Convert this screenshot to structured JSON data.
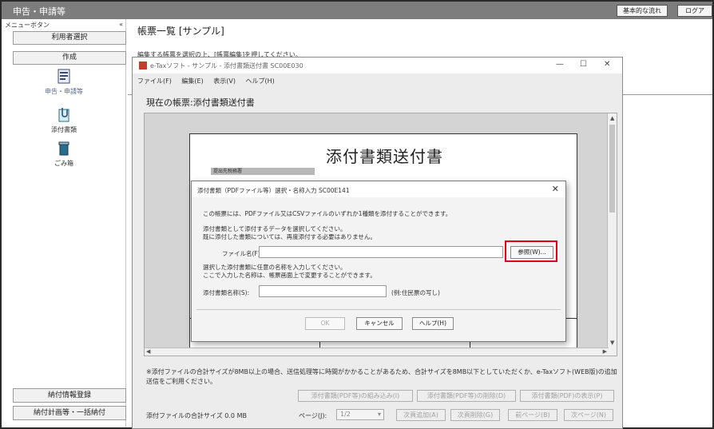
{
  "app": {
    "title": "申告・申請等",
    "top_buttons": [
      "基本的な流れ",
      "ログア"
    ]
  },
  "left_menu": {
    "header_label": "メニューボタン",
    "header_close": "«",
    "buttons": [
      "利用者選択",
      "作成"
    ],
    "icons": [
      {
        "label": "申告・申請等",
        "icon": "document-form-icon"
      },
      {
        "label": "添付書類",
        "icon": "clip-document-icon"
      },
      {
        "label": "ごみ箱",
        "icon": "trash-icon"
      }
    ],
    "bottom_buttons": [
      "納付情報登録",
      "納付計画等・一括納付"
    ]
  },
  "main": {
    "title": "帳票一覧 [サンプル]",
    "subtitle": "編集する帳票を選択の上、[帳票編集]を押してください。"
  },
  "etax_window": {
    "title": "e-Taxソフト - サンプル - 添付書類送付書 SC00E030",
    "controls": [
      "—",
      "☐",
      "✕"
    ],
    "menu": [
      "ファイル(F)",
      "編集(E)",
      "表示(V)",
      "ヘルプ(H)"
    ],
    "current_form": "現在の帳票:添付書類送付書",
    "doc_title": "添付書類送付書",
    "doc_field_label": "提出先税務署",
    "note": "※添付ファイルの合計サイズが8MB以上の場合、送信処理等に時間がかかることがあるため、合計サイズを8MB以下としていただくか、e-Taxソフト(WEB版)の追加送信をご利用ください。",
    "buttons_row1": [
      "添付書類(PDF等)の組み込み(I)",
      "添付書類(PDF等)の削除(D)",
      "添付書類(PDF)の表示(P)"
    ],
    "size_label": "添付ファイルの合計サイズ  0.0 MB",
    "page_label": "ページ(J):",
    "page_value": "1/2",
    "buttons_row2": [
      "次頁追加(A)",
      "次頁削除(G)",
      "前ページ(B)",
      "次ページ(N)"
    ]
  },
  "dialog": {
    "title": "添付書類（PDFファイル等）選択・名称入力 SC00E141",
    "text1": "この帳票には、PDFファイル又はCSVファイルのいずれか1種類を添付することができます。",
    "text2a": "添付書類として添付するデータを選択してください。",
    "text2b": "既に添付した書類については、再度添付する必要はありません。",
    "file_label": "ファイル名(F):",
    "browse_label": "参照(W)...",
    "text3a": "選択した添付書類に任意の名称を入力してください。",
    "text3b": "ここで入力した名称は、帳票画面上で変更することができます。",
    "name_label": "添付書類名称(S):",
    "name_example": "(例:住民票の写し)",
    "ok_label": "OK",
    "cancel_label": "キャンセル",
    "help_label": "ヘルプ(H)"
  },
  "colors": {
    "topbar": "#7d7d7d",
    "highlight": "#e0001b"
  }
}
